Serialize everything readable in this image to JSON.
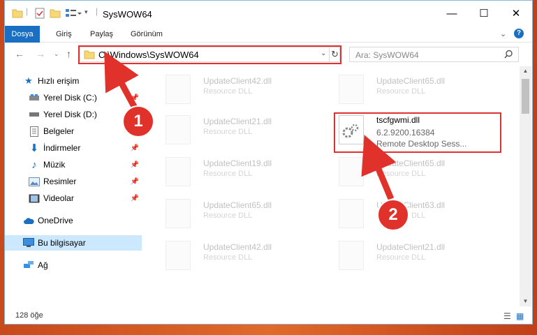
{
  "window": {
    "title": "SysWOW64",
    "minimize": "—",
    "maximize": "☐",
    "close": "✕"
  },
  "ribbon": {
    "tabs": [
      "Dosya",
      "Giriş",
      "Paylaş",
      "Görünüm"
    ]
  },
  "address": {
    "path": "C:\\Windows\\SysWOW64",
    "search_placeholder": "Ara: SysWOW64"
  },
  "nav": {
    "items": [
      {
        "label": "Hızlı erişim",
        "icon": "star-icon"
      },
      {
        "label": "Yerel Disk (C:)",
        "icon": "drive-icon"
      },
      {
        "label": "Yerel Disk (D:)",
        "icon": "drive-icon"
      },
      {
        "label": "Belgeler",
        "icon": "document-icon"
      },
      {
        "label": "İndirmeler",
        "icon": "download-icon"
      },
      {
        "label": "Müzik",
        "icon": "music-icon"
      },
      {
        "label": "Resimler",
        "icon": "picture-icon"
      },
      {
        "label": "Videolar",
        "icon": "video-icon"
      },
      {
        "label": "OneDrive",
        "icon": "cloud-icon"
      },
      {
        "label": "Bu bilgisayar",
        "icon": "computer-icon"
      },
      {
        "label": "Ağ",
        "icon": "network-icon"
      }
    ]
  },
  "files": [
    {
      "name": "UpdateClient42.dll",
      "type": "Resource DLL"
    },
    {
      "name": "UpdateClient65.dll",
      "type": "Resource DLL"
    },
    {
      "name": "UpdateClient21.dll",
      "type": "Resource DLL"
    },
    {
      "name": "tscfgwmi.dll",
      "version": "6.2.9200.16384",
      "desc": "Remote Desktop Sess..."
    },
    {
      "name": "UpdateClient19.dll",
      "type": "Resource DLL"
    },
    {
      "name": "UpdateClient65.dll",
      "type": "Resource DLL"
    },
    {
      "name": "UpdateClient65.dll",
      "type": "Resource DLL"
    },
    {
      "name": "UpdateClient63.dll",
      "type": "Resource DLL"
    },
    {
      "name": "UpdateClient42.dll",
      "type": "Resource DLL"
    },
    {
      "name": "UpdateClient21.dll",
      "type": "Resource DLL"
    }
  ],
  "status": {
    "count": "128 öğe"
  },
  "annotations": {
    "step1": "1",
    "step2": "2",
    "color": "#e0312a"
  }
}
